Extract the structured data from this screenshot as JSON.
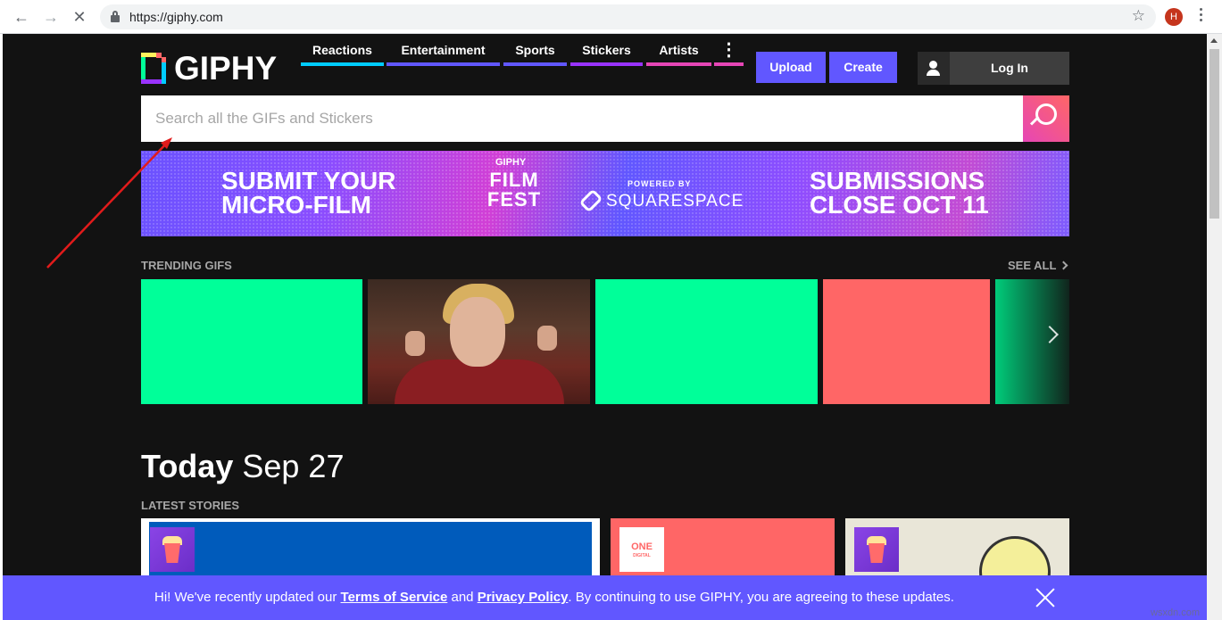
{
  "browser": {
    "url": "https://giphy.com",
    "profile_initial": "H",
    "back_icon": "arrow-left-icon",
    "forward_icon": "arrow-right-icon",
    "stop_icon": "close-icon"
  },
  "header": {
    "logo_text": "GIPHY",
    "nav": [
      {
        "label": "Reactions",
        "color": "#00ccff"
      },
      {
        "label": "Entertainment",
        "color": "#6157ff"
      },
      {
        "label": "Sports",
        "color": "#6157ff"
      },
      {
        "label": "Stickers",
        "color": "#9933ff"
      },
      {
        "label": "Artists",
        "color": "#e646b6"
      }
    ],
    "upload_label": "Upload",
    "create_label": "Create",
    "login_label": "Log In"
  },
  "search": {
    "placeholder": "Search all the GIFs and Stickers"
  },
  "banner": {
    "left_line1": "SUBMIT YOUR",
    "left_line2": "MICRO-FILM",
    "brand": "GIPHY",
    "fest_line1": "FILM",
    "fest_line2": "FEST",
    "powered_by": "POWERED BY",
    "sponsor": "SQUARESPACE",
    "right_line1": "SUBMISSIONS",
    "right_line2": "CLOSE OCT 11"
  },
  "trending": {
    "label": "TRENDING GIFS",
    "see_all": "SEE ALL",
    "tiles": [
      {
        "color": "#00ff99"
      },
      {
        "color": "photo"
      },
      {
        "color": "#00ff99"
      },
      {
        "color": "#ff6666"
      },
      {
        "color": "#00ff99"
      }
    ]
  },
  "today": {
    "word": "Today",
    "date": "Sep 27",
    "stories_label": "LATEST STORIES"
  },
  "notice": {
    "text_before": "Hi! We've recently updated our ",
    "terms_link": "Terms of Service",
    "text_and": " and ",
    "privacy_link": "Privacy Policy",
    "text_after": ". By continuing to use GIPHY, you are agreeing to these updates."
  },
  "watermark": "wsxdn.com",
  "colors": {
    "accent": "#6157ff",
    "page_bg": "#121212",
    "green": "#00ff99",
    "coral": "#ff6666"
  }
}
